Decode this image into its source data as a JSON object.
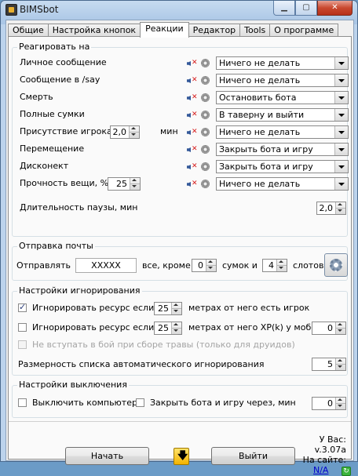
{
  "window": {
    "title": "BIMSbot",
    "minimize_glyph": "▁",
    "maximize_glyph": "▢",
    "close_glyph": "✕"
  },
  "tabs": [
    "Общие",
    "Настройка кнопок",
    "Реакции",
    "Редактор",
    "Tools",
    "О программе"
  ],
  "active_tab": "Реакции",
  "reactions": {
    "title": "Реагировать на",
    "rows": [
      {
        "label": "Личное сообщение",
        "action": "Ничего не делать"
      },
      {
        "label": "Сообщение в /say",
        "action": "Ничего не делать"
      },
      {
        "label": "Смерть",
        "action": "Остановить бота"
      },
      {
        "label": "Полные сумки",
        "action": "В таверну и выйти"
      },
      {
        "label": "Присутствие игрока",
        "action": "Ничего не делать",
        "spin_value": "2,0",
        "unit": "мин"
      },
      {
        "label": "Перемещение",
        "action": "Закрыть бота и игру"
      },
      {
        "label": "Дисконект",
        "action": "Закрыть бота и игру"
      },
      {
        "label": "Прочность вещи, % <",
        "action": "Ничего не делать",
        "spin_value": "25"
      }
    ],
    "pause_label": "Длительность паузы, мин",
    "pause_value": "2,0"
  },
  "mail": {
    "title": "Отправка почты",
    "send_label": "Отправлять",
    "recipient": "XXXXX",
    "except_label": "все, кроме",
    "bags_value": "0",
    "bags_label": "сумок и",
    "slots_value": "4",
    "slots_label": "слотов"
  },
  "ignore": {
    "title": "Настройки игнорирования",
    "opt1": {
      "checked": true,
      "label": "Игнорировать ресурс если в",
      "value": "25",
      "suffix": "метрах от него есть игрок"
    },
    "opt2": {
      "checked": false,
      "label": "Игнорировать ресурс если в",
      "value": "25",
      "suffix": "метрах от него XP(k) у мобов >",
      "xp_value": "0"
    },
    "opt3": {
      "checked": false,
      "label": "Не вступать в бой при сборе травы (только для друидов)"
    },
    "size_label": "Размерность списка автоматического игнорирования",
    "size_value": "5"
  },
  "shutdown": {
    "title": "Настройки выключения",
    "pc_label": "Выключить компьютер",
    "close_label": "Закрыть бота и игру через, мин",
    "close_value": "0"
  },
  "footer": {
    "start_label": "Начать",
    "exit_label": "Выйти",
    "arrow_glyph": "🡇",
    "you_label": "У Вас:",
    "version": "v.3.07a",
    "site_label": "На сайте:",
    "site_value": "N/A",
    "refresh_glyph": "↻"
  },
  "colors": {
    "window_frame": "#bcd3ec",
    "close_button": "#c9482f",
    "link": "#0000cc"
  }
}
